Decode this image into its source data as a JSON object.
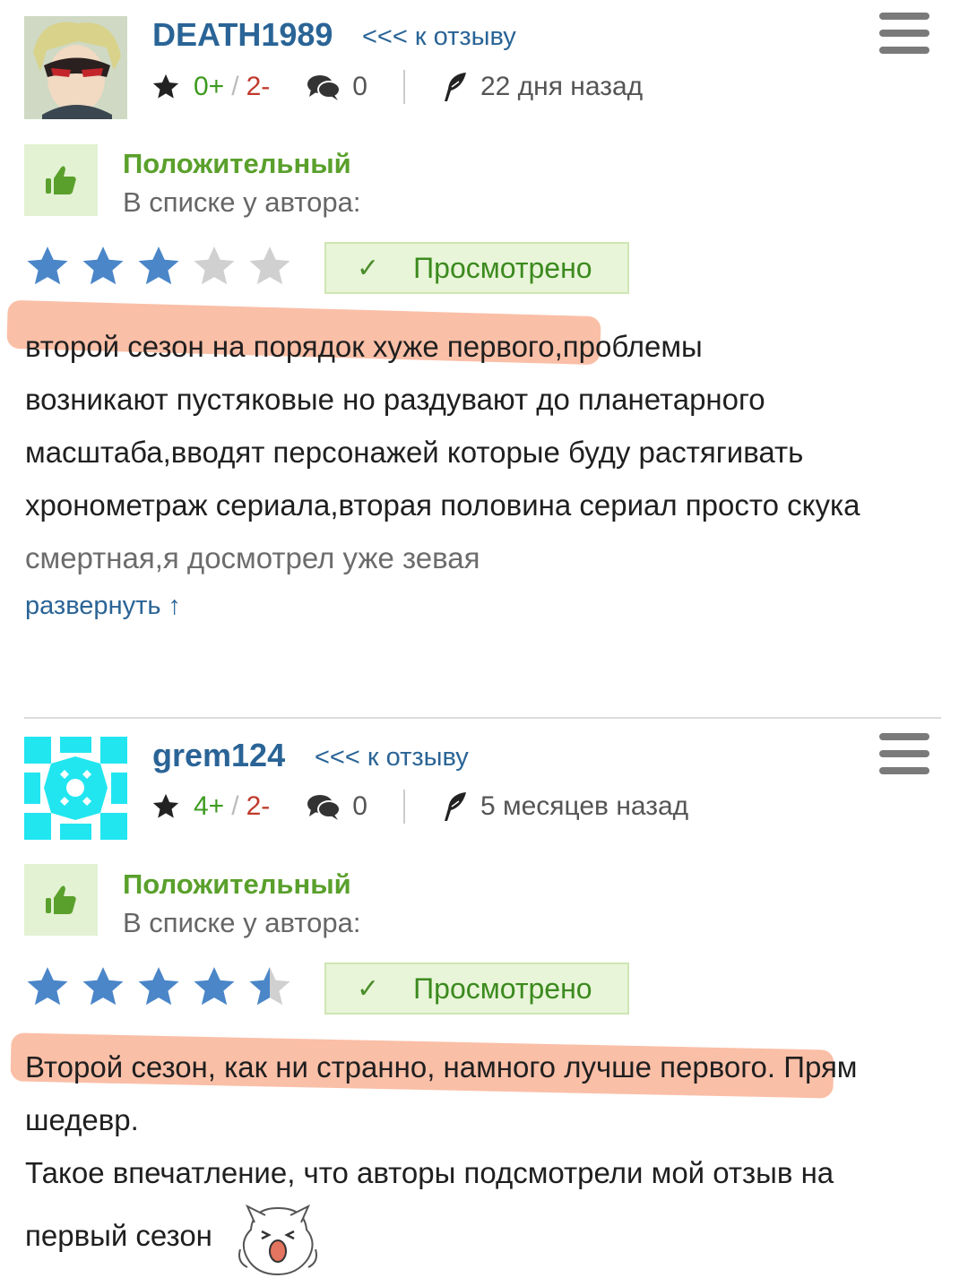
{
  "reviews": [
    {
      "username": "DEATH1989",
      "back_link": "<<< к отзыву",
      "votes_plus": "0+",
      "votes_sep": "/",
      "votes_minus": "2-",
      "comments": "0",
      "date": "22 дня назад",
      "type": "Положительный",
      "list_label": "В списке у автора:",
      "rating": 3,
      "rating_max": 5,
      "status": "Просмотрено",
      "text_lines": [
        "второй сезон на порядок хуже первого,проблемы",
        "возникают пустяковые но раздувают до планетарного",
        "масштаба,вводят персонажей которые буду растягивать",
        "хронометраж сериала,вторая половина сериал просто скука",
        "смертная,я досмотрел уже зевая"
      ],
      "expand_label": "развернуть ↑"
    },
    {
      "username": "grem124",
      "back_link": "<<< к отзыву",
      "votes_plus": "4+",
      "votes_sep": "/",
      "votes_minus": "2-",
      "comments": "0",
      "date": "5 месяцев назад",
      "type": "Положительный",
      "list_label": "В списке у автора:",
      "rating": 4.5,
      "rating_max": 5,
      "status": "Просмотрено",
      "text_lines": [
        "Второй сезон, как ни странно, намного лучше первого. Прям",
        "шедевр.",
        "Такое впечатление, что авторы подсмотрели мой отзыв на",
        "первый сезон"
      ]
    }
  ],
  "colors": {
    "link": "#2a6496",
    "positive": "#5aa02c",
    "star_filled": "#4a86c8",
    "star_empty": "#d0d0d0",
    "highlight": "#f8a98a"
  },
  "icons": [
    "star-icon",
    "comments-icon",
    "quill-icon",
    "thumbs-up-icon",
    "check-icon",
    "menu-icon",
    "sticker-emoji"
  ]
}
